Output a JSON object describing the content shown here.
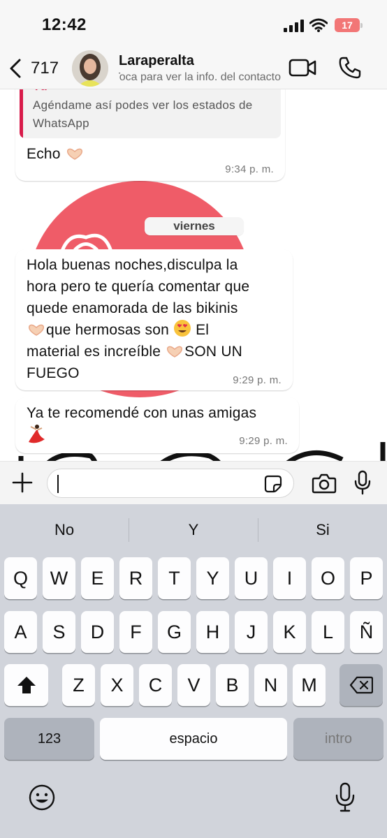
{
  "status_bar": {
    "time": "12:42",
    "battery": "17"
  },
  "header": {
    "back_count": "717",
    "contact_name": "Laraperalta",
    "contact_subtitle": "Toca para ver la info. del contacto"
  },
  "messages": {
    "quoted": {
      "author": "Tú",
      "text_line1": "Agéndame así podes ver los estados de",
      "text_line2": "WhatsApp"
    },
    "reply_text": "Echo",
    "reply_time": "9:34 p. m.",
    "date_label": "viernes",
    "msg2_lines": [
      "Hola buenas noches,disculpa la",
      "hora pero te quería comentar que",
      "quede enamorada de las bikinis",
      "que hermosas son",
      "material es increíble",
      "FUEGO"
    ],
    "msg2_words": {
      "el": "El",
      "son_un": "SON UN"
    },
    "msg2_time": "9:29 p. m.",
    "msg3_text": "Ya te recomendé con unas amigas",
    "msg3_time": "9:29 p. m."
  },
  "suggestions": [
    "No",
    "Y",
    "Si"
  ],
  "keyboard": {
    "row1": [
      "Q",
      "W",
      "E",
      "R",
      "T",
      "Y",
      "U",
      "I",
      "O",
      "P"
    ],
    "row2": [
      "A",
      "S",
      "D",
      "F",
      "G",
      "H",
      "J",
      "K",
      "L",
      "Ñ"
    ],
    "row3": [
      "Z",
      "X",
      "C",
      "V",
      "B",
      "N",
      "M"
    ],
    "numbers_key": "123",
    "space_key": "espacio",
    "return_key": "intro"
  },
  "colors": {
    "accent_red": "#d81b4a",
    "battery": "#f27676",
    "background_circle": "#ef5c68"
  }
}
